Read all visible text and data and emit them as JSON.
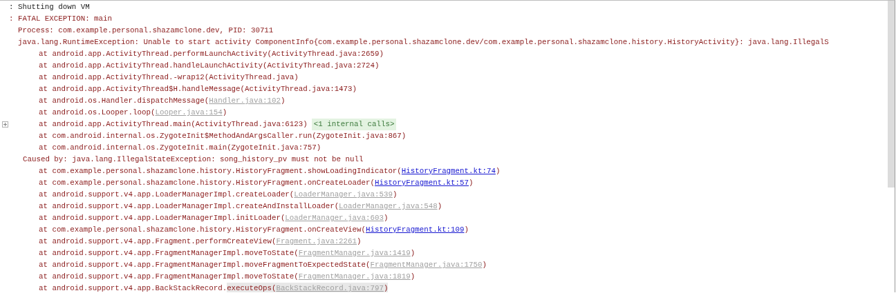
{
  "console": {
    "lines": [
      {
        "kind": "header",
        "foldable": false,
        "segments": [
          {
            "kind": "text",
            "text": ": Shutting down VM"
          }
        ]
      },
      {
        "kind": "header",
        "foldable": false,
        "segments": [
          {
            "kind": "error",
            "text": ": FATAL EXCEPTION: main"
          }
        ]
      },
      {
        "kind": "detail",
        "foldable": false,
        "segments": [
          {
            "kind": "error",
            "text": "Process: com.example.personal.shazamclone.dev, PID: 30711"
          }
        ]
      },
      {
        "kind": "detail",
        "foldable": false,
        "segments": [
          {
            "kind": "error",
            "text": "java.lang.RuntimeException: Unable to start activity ComponentInfo{com.example.personal.shazamclone.dev/com.example.personal.shazamclone.history.HistoryActivity}: java.lang.IllegalS"
          }
        ]
      },
      {
        "kind": "frame",
        "foldable": false,
        "segments": [
          {
            "kind": "error",
            "text": "at android.app.ActivityThread.performLaunchActivity(ActivityThread.java:2659)"
          }
        ]
      },
      {
        "kind": "frame",
        "foldable": false,
        "segments": [
          {
            "kind": "error",
            "text": "at android.app.ActivityThread.handleLaunchActivity(ActivityThread.java:2724)"
          }
        ]
      },
      {
        "kind": "frame",
        "foldable": false,
        "segments": [
          {
            "kind": "error",
            "text": "at android.app.ActivityThread.-wrap12(ActivityThread.java)"
          }
        ]
      },
      {
        "kind": "frame",
        "foldable": false,
        "segments": [
          {
            "kind": "error",
            "text": "at android.app.ActivityThread$H.handleMessage(ActivityThread.java:1473)"
          }
        ]
      },
      {
        "kind": "frame",
        "foldable": false,
        "segments": [
          {
            "kind": "error",
            "text": "at android.os.Handler.dispatchMessage("
          },
          {
            "kind": "lib",
            "text": "Handler.java:102"
          },
          {
            "kind": "error",
            "text": ")"
          }
        ]
      },
      {
        "kind": "frame",
        "foldable": false,
        "segments": [
          {
            "kind": "error",
            "text": "at android.os.Looper.loop("
          },
          {
            "kind": "lib",
            "text": "Looper.java:154"
          },
          {
            "kind": "error",
            "text": ")"
          }
        ]
      },
      {
        "kind": "frame",
        "foldable": true,
        "segments": [
          {
            "kind": "error",
            "text": "at android.app.ActivityThread.main(ActivityThread.java:6123)"
          },
          {
            "kind": "folded",
            "text": "<1 internal calls>"
          }
        ]
      },
      {
        "kind": "frame",
        "foldable": false,
        "segments": [
          {
            "kind": "error",
            "text": "at com.android.internal.os.ZygoteInit$MethodAndArgsCaller.run(ZygoteInit.java:867)"
          }
        ]
      },
      {
        "kind": "frame",
        "foldable": false,
        "segments": [
          {
            "kind": "error",
            "text": "at com.android.internal.os.ZygoteInit.main(ZygoteInit.java:757)"
          }
        ]
      },
      {
        "kind": "cause",
        "foldable": false,
        "segments": [
          {
            "kind": "error",
            "text": "Caused by: java.lang.IllegalStateException: song_history_pv must not be null"
          }
        ]
      },
      {
        "kind": "frame",
        "foldable": false,
        "segments": [
          {
            "kind": "error",
            "text": "at com.example.personal.shazamclone.history.HistoryFragment.showLoadingIndicator("
          },
          {
            "kind": "proj",
            "text": "HistoryFragment.kt:74"
          },
          {
            "kind": "error",
            "text": ")"
          }
        ]
      },
      {
        "kind": "frame",
        "foldable": false,
        "segments": [
          {
            "kind": "error",
            "text": "at com.example.personal.shazamclone.history.HistoryFragment.onCreateLoader("
          },
          {
            "kind": "proj",
            "text": "HistoryFragment.kt:57"
          },
          {
            "kind": "error",
            "text": ")"
          }
        ]
      },
      {
        "kind": "frame",
        "foldable": false,
        "segments": [
          {
            "kind": "error",
            "text": "at android.support.v4.app.LoaderManagerImpl.createLoader("
          },
          {
            "kind": "lib",
            "text": "LoaderManager.java:539"
          },
          {
            "kind": "error",
            "text": ")"
          }
        ]
      },
      {
        "kind": "frame",
        "foldable": false,
        "segments": [
          {
            "kind": "error",
            "text": "at android.support.v4.app.LoaderManagerImpl.createAndInstallLoader("
          },
          {
            "kind": "lib",
            "text": "LoaderManager.java:548"
          },
          {
            "kind": "error",
            "text": ")"
          }
        ]
      },
      {
        "kind": "frame",
        "foldable": false,
        "segments": [
          {
            "kind": "error",
            "text": "at android.support.v4.app.LoaderManagerImpl.initLoader("
          },
          {
            "kind": "lib",
            "text": "LoaderManager.java:603"
          },
          {
            "kind": "error",
            "text": ")"
          }
        ]
      },
      {
        "kind": "frame",
        "foldable": false,
        "segments": [
          {
            "kind": "error",
            "text": "at com.example.personal.shazamclone.history.HistoryFragment.onCreateView("
          },
          {
            "kind": "proj",
            "text": "HistoryFragment.kt:109"
          },
          {
            "kind": "error",
            "text": ")"
          }
        ]
      },
      {
        "kind": "frame",
        "foldable": false,
        "segments": [
          {
            "kind": "error",
            "text": "at android.support.v4.app.Fragment.performCreateView("
          },
          {
            "kind": "lib",
            "text": "Fragment.java:2261"
          },
          {
            "kind": "error",
            "text": ")"
          }
        ]
      },
      {
        "kind": "frame",
        "foldable": false,
        "segments": [
          {
            "kind": "error",
            "text": "at android.support.v4.app.FragmentManagerImpl.moveToState("
          },
          {
            "kind": "lib",
            "text": "FragmentManager.java:1419"
          },
          {
            "kind": "error",
            "text": ")"
          }
        ]
      },
      {
        "kind": "frame",
        "foldable": false,
        "segments": [
          {
            "kind": "error",
            "text": "at android.support.v4.app.FragmentManagerImpl.moveFragmentToExpectedState("
          },
          {
            "kind": "lib",
            "text": "FragmentManager.java:1750"
          },
          {
            "kind": "error",
            "text": ")"
          }
        ]
      },
      {
        "kind": "frame",
        "foldable": false,
        "segments": [
          {
            "kind": "error",
            "text": "at android.support.v4.app.FragmentManagerImpl.moveToState("
          },
          {
            "kind": "lib",
            "text": "FragmentManager.java:1819"
          },
          {
            "kind": "error",
            "text": ")"
          }
        ]
      },
      {
        "kind": "frame",
        "foldable": false,
        "segments": [
          {
            "kind": "error",
            "text": "at android.support.v4.app.BackStackRecord."
          },
          {
            "kind": "marked",
            "text": "executeOps("
          },
          {
            "kind": "marked-lib",
            "text": "BackStackRecord.java:797"
          },
          {
            "kind": "marked",
            "text": ")"
          }
        ]
      }
    ]
  }
}
